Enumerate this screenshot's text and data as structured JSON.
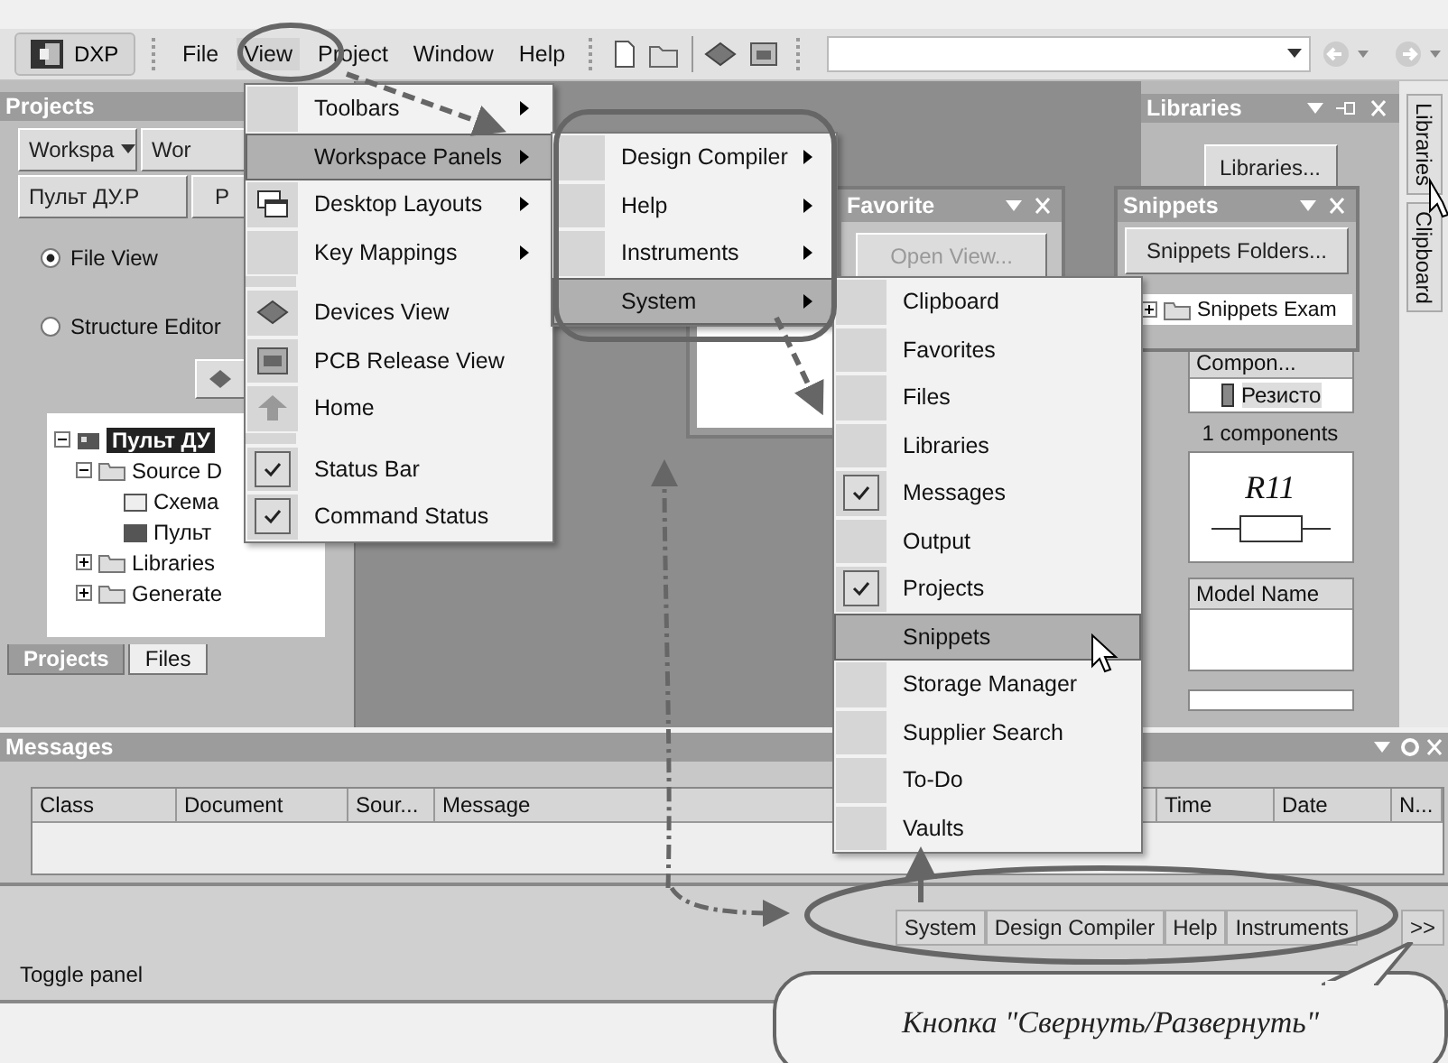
{
  "toolbar": {
    "app_button": "DXP",
    "menus": [
      {
        "label": "File",
        "selected": false
      },
      {
        "label": "View",
        "selected": true
      },
      {
        "label": "Project",
        "selected": false
      },
      {
        "label": "Window",
        "selected": false
      },
      {
        "label": "Help",
        "selected": false
      }
    ]
  },
  "projects_panel": {
    "title": "Projects",
    "workspace_dropdown": "Workspa",
    "workspace_button": "Wor",
    "project_button": "Пульт ДУ.P",
    "project_button_2": "P",
    "view_options": [
      {
        "label": "File View",
        "selected": true
      },
      {
        "label": "Structure Editor",
        "selected": false
      }
    ],
    "tree": [
      {
        "label": "Пульт ДУ",
        "selected": true,
        "expanded": true,
        "children": [
          {
            "label": "Source D",
            "selected": false,
            "expanded": true,
            "children": [
              {
                "label": "Схема",
                "selected": false
              },
              {
                "label": "Пульт",
                "selected": false
              }
            ]
          },
          {
            "label": "Libraries",
            "selected": false,
            "expanded": false
          },
          {
            "label": "Generate",
            "selected": false,
            "expanded": false
          }
        ]
      }
    ],
    "tabs": [
      {
        "label": "Projects",
        "selected": true
      },
      {
        "label": "Files",
        "selected": false
      }
    ]
  },
  "favorite_panel": {
    "title": "Favorite",
    "button": "Open View..."
  },
  "snippets_panel": {
    "title": "Snippets",
    "button": "Snippets Folders...",
    "tree": [
      {
        "label": "Snippets Exam",
        "expanded": false
      }
    ]
  },
  "libraries_panel": {
    "title": "Libraries",
    "button": "Libraries...",
    "component_header": "Compon...",
    "components": [
      "Резисто"
    ],
    "count": "1 components",
    "preview_label": "R11",
    "model_header": "Model Name"
  },
  "side_tabs": [
    {
      "label": "Libraries"
    },
    {
      "label": "Clipboard"
    }
  ],
  "view_menu": {
    "groups": [
      [
        {
          "label": "Toolbars",
          "has_submenu": true,
          "checked": false,
          "selected": false
        },
        {
          "label": "Workspace Panels",
          "has_submenu": true,
          "checked": false,
          "selected": true
        },
        {
          "label": "Desktop Layouts",
          "has_submenu": true,
          "checked": false,
          "selected": false
        },
        {
          "label": "Key Mappings",
          "has_submenu": true,
          "checked": false,
          "selected": false
        }
      ],
      [
        {
          "label": "Devices View",
          "has_submenu": false,
          "checked": false,
          "selected": false
        },
        {
          "label": "PCB Release View",
          "has_submenu": false,
          "checked": false,
          "selected": false
        },
        {
          "label": "Home",
          "has_submenu": false,
          "checked": false,
          "selected": false
        }
      ],
      [
        {
          "label": "Status Bar",
          "has_submenu": false,
          "checked": true,
          "selected": false
        },
        {
          "label": "Command Status",
          "has_submenu": false,
          "checked": true,
          "selected": false
        }
      ]
    ]
  },
  "panels_menu": {
    "items": [
      {
        "label": "Design Compiler",
        "has_submenu": true,
        "selected": false
      },
      {
        "label": "Help",
        "has_submenu": true,
        "selected": false
      },
      {
        "label": "Instruments",
        "has_submenu": true,
        "selected": false
      },
      {
        "label": "System",
        "has_submenu": true,
        "selected": true
      }
    ]
  },
  "system_menu": {
    "items": [
      {
        "label": "Clipboard",
        "checked": false,
        "selected": false
      },
      {
        "label": "Favorites",
        "checked": false,
        "selected": false
      },
      {
        "label": "Files",
        "checked": false,
        "selected": false
      },
      {
        "label": "Libraries",
        "checked": false,
        "selected": false
      },
      {
        "label": "Messages",
        "checked": true,
        "selected": false
      },
      {
        "label": "Output",
        "checked": false,
        "selected": false
      },
      {
        "label": "Projects",
        "checked": true,
        "selected": false
      },
      {
        "label": "Snippets",
        "checked": false,
        "selected": true
      },
      {
        "label": "Storage Manager",
        "checked": false,
        "selected": false
      },
      {
        "label": "Supplier Search",
        "checked": false,
        "selected": false
      },
      {
        "label": "To-Do",
        "checked": false,
        "selected": false
      },
      {
        "label": "Vaults",
        "checked": false,
        "selected": false
      }
    ]
  },
  "messages_panel": {
    "title": "Messages",
    "columns": [
      "Class",
      "Document",
      "Sour...",
      "Message",
      "Time",
      "Date",
      "N..."
    ]
  },
  "panel_bar": {
    "buttons": [
      "System",
      "Design Compiler",
      "Help",
      "Instruments"
    ],
    "more": ">>"
  },
  "status_bar": {
    "text": "Toggle panel"
  },
  "callout": {
    "text": "Кнопка \"Свернуть/Развернуть\""
  }
}
